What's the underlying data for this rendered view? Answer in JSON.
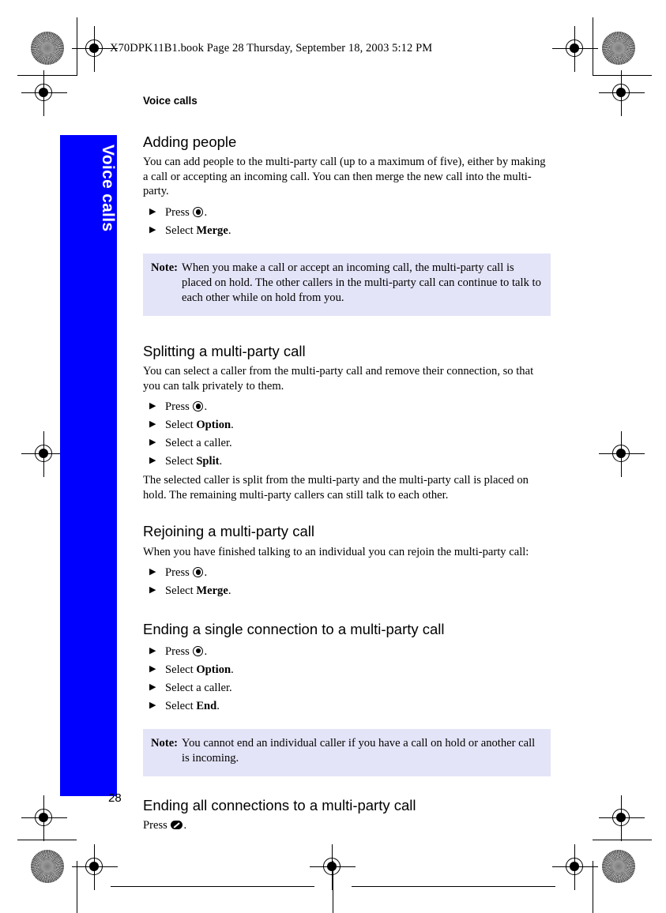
{
  "header": {
    "file_line": "X70DPK11B1.book  Page 28  Thursday, September 18, 2003  5:12 PM"
  },
  "side_tab": {
    "label": "Voice calls",
    "color": "#0000ff",
    "text_color": "#ffffff"
  },
  "running_head": "Voice calls",
  "footer": {
    "page_number": "28"
  },
  "note_style": {
    "background": "#e4e4f8"
  },
  "sections": [
    {
      "title": "Adding people",
      "paragraphs": [
        "You can add people to the multi-party call (up to a maximum of five), either by making a call or accepting an incoming call. You can then merge the new call into the multi-party."
      ],
      "steps": [
        {
          "prefix": "Press ",
          "icon": "nav-key-icon",
          "strong": "",
          "suffix": "."
        },
        {
          "prefix": "Select ",
          "icon": "",
          "strong": "Merge",
          "suffix": "."
        }
      ],
      "note": {
        "label": "Note:",
        "text": "When you make a call or accept an incoming call, the multi-party call is placed on hold. The other callers in the multi-party call can continue to talk to each other while on hold from you."
      }
    },
    {
      "title": "Splitting a multi-party call",
      "paragraphs": [
        "You can select a caller from the multi-party call and remove their connection, so that you can talk privately to them."
      ],
      "steps": [
        {
          "prefix": "Press ",
          "icon": "nav-key-icon",
          "strong": "",
          "suffix": "."
        },
        {
          "prefix": "Select ",
          "icon": "",
          "strong": "Option",
          "suffix": "."
        },
        {
          "prefix": "Select a caller.",
          "icon": "",
          "strong": "",
          "suffix": ""
        },
        {
          "prefix": "Select ",
          "icon": "",
          "strong": "Split",
          "suffix": "."
        }
      ],
      "trailing_paragraphs": [
        "The selected caller is split from the multi-party and the multi-party call is placed on hold. The remaining multi-party callers can still talk to each other."
      ]
    },
    {
      "title": "Rejoining a multi-party call",
      "paragraphs": [
        "When you have finished talking to an individual you can rejoin the multi-party call:"
      ],
      "steps": [
        {
          "prefix": "Press ",
          "icon": "nav-key-icon",
          "strong": "",
          "suffix": "."
        },
        {
          "prefix": "Select ",
          "icon": "",
          "strong": "Merge",
          "suffix": "."
        }
      ]
    },
    {
      "title": "Ending a single connection to a multi-party call",
      "paragraphs": [],
      "steps": [
        {
          "prefix": "Press ",
          "icon": "nav-key-icon",
          "strong": "",
          "suffix": "."
        },
        {
          "prefix": "Select ",
          "icon": "",
          "strong": "Option",
          "suffix": "."
        },
        {
          "prefix": "Select a caller.",
          "icon": "",
          "strong": "",
          "suffix": ""
        },
        {
          "prefix": "Select ",
          "icon": "",
          "strong": "End",
          "suffix": "."
        }
      ],
      "note": {
        "label": "Note:",
        "text": "You cannot end an individual caller if you have a call on hold or another call is incoming."
      }
    },
    {
      "title": "Ending all connections to a multi-party call",
      "press_line": {
        "prefix": "Press ",
        "icon": "end-call-key-icon",
        "suffix": "."
      }
    }
  ]
}
